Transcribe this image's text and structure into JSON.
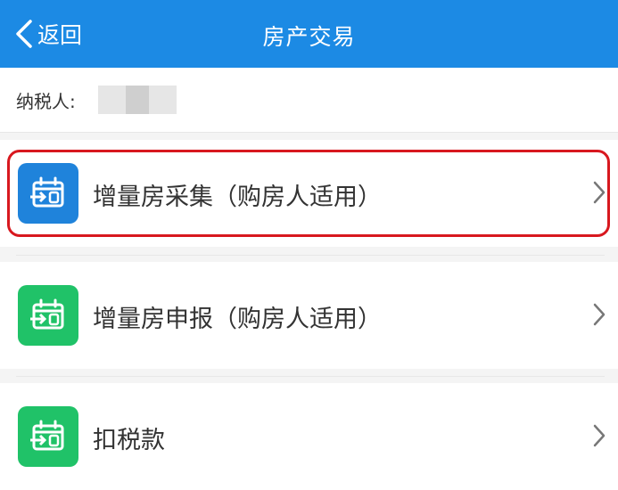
{
  "header": {
    "back_label": "返回",
    "title": "房产交易",
    "background": "#1c8ae4"
  },
  "taxpayer": {
    "label": "纳税人:"
  },
  "menu": {
    "items": [
      {
        "label": "增量房采集（购房人适用）",
        "icon": "calendar-arrow-icon",
        "icon_color": "#1f83db",
        "highlighted": true
      },
      {
        "label": "增量房申报（购房人适用）",
        "icon": "calendar-arrow-icon",
        "icon_color": "#20c268",
        "highlighted": false
      },
      {
        "label": "扣税款",
        "icon": "calendar-arrow-icon",
        "icon_color": "#20c268",
        "highlighted": false
      }
    ]
  },
  "highlight_color": "#d8181f"
}
